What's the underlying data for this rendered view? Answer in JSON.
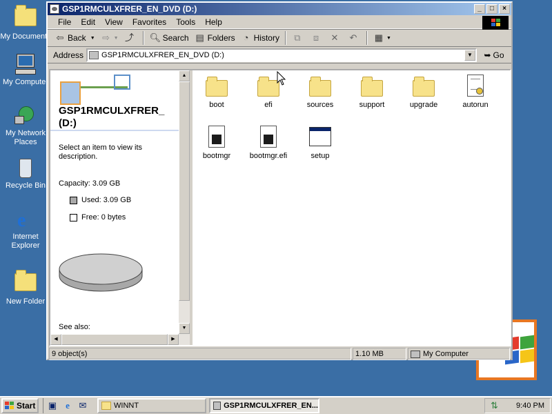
{
  "desktop": {
    "icons": [
      {
        "label": "My Documents"
      },
      {
        "label": "My Computer"
      },
      {
        "label": "My Network Places"
      },
      {
        "label": "Recycle Bin"
      },
      {
        "label": "Internet Explorer"
      },
      {
        "label": "New Folder"
      }
    ]
  },
  "window": {
    "title": "GSP1RMCULXFRER_EN_DVD (D:)",
    "menu": [
      "File",
      "Edit",
      "View",
      "Favorites",
      "Tools",
      "Help"
    ],
    "toolbar": {
      "back": "Back",
      "search": "Search",
      "folders": "Folders",
      "history": "History"
    },
    "address": {
      "label": "Address",
      "value": "GSP1RMCULXFRER_EN_DVD (D:)",
      "go": "Go"
    },
    "leftpane": {
      "title_line1": "GSP1RMCULXFRER_",
      "title_line2": "(D:)",
      "description": "Select an item to view its description.",
      "capacity": "Capacity: 3.09 GB",
      "used": "Used: 3.09 GB",
      "free": "Free: 0 bytes",
      "see_also": "See also:"
    },
    "files": [
      {
        "name": "boot",
        "type": "folder"
      },
      {
        "name": "efi",
        "type": "folder"
      },
      {
        "name": "sources",
        "type": "folder"
      },
      {
        "name": "support",
        "type": "folder"
      },
      {
        "name": "upgrade",
        "type": "folder"
      },
      {
        "name": "autorun",
        "type": "inf"
      },
      {
        "name": "bootmgr",
        "type": "system"
      },
      {
        "name": "bootmgr.efi",
        "type": "system"
      },
      {
        "name": "setup",
        "type": "app"
      }
    ],
    "status": {
      "objects": "9 object(s)",
      "size": "1.10 MB",
      "zone": "My Computer"
    }
  },
  "taskbar": {
    "start": "Start",
    "tasks": [
      {
        "label": "WINNT",
        "active": false
      },
      {
        "label": "GSP1RMCULXFRER_EN...",
        "active": true
      }
    ],
    "clock": "9:40 PM"
  }
}
